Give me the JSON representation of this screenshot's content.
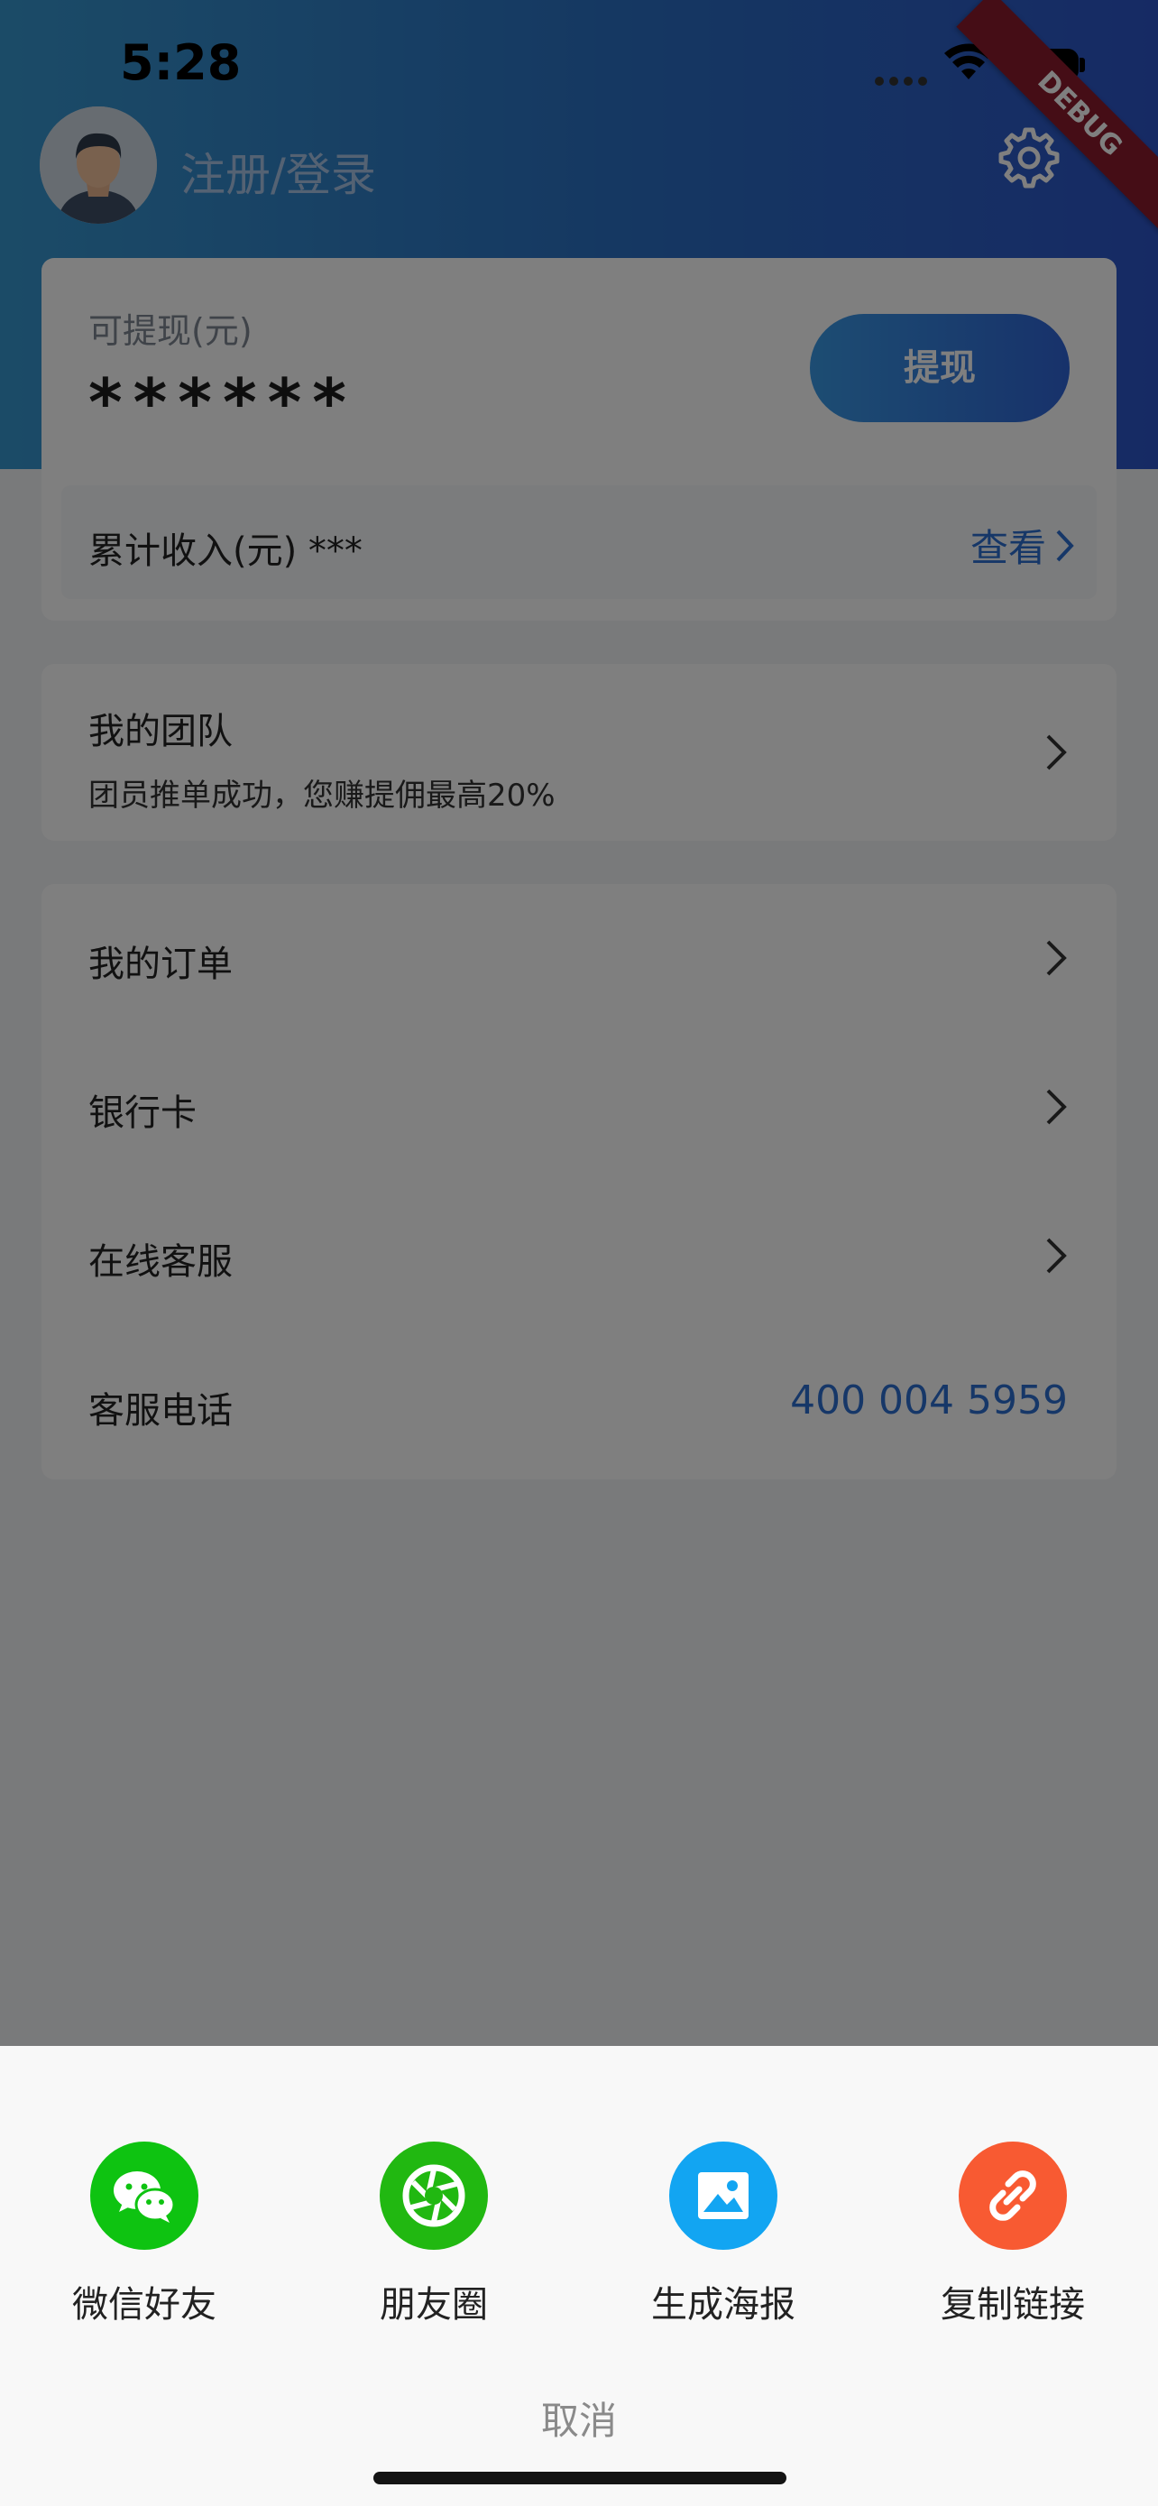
{
  "status_bar": {
    "time": "5:28",
    "debug_label": "DEBUG"
  },
  "header": {
    "login_text": "注册/登录"
  },
  "balance_card": {
    "withdrawable_label": "可提现(元)",
    "withdrawable_value": "******",
    "withdraw_button": "提现",
    "income_label": "累计收入(元) ***",
    "view_link": "查看"
  },
  "team_card": {
    "title": "我的团队",
    "subtitle": "团员推单成功，您赚提佣最高20%"
  },
  "menu": {
    "items": [
      {
        "label": "我的订单"
      },
      {
        "label": "银行卡"
      },
      {
        "label": "在线客服"
      },
      {
        "label": "客服电话",
        "value": "400 004 5959"
      }
    ]
  },
  "share_sheet": {
    "items": [
      {
        "label": "微信好友",
        "icon": "wechat-icon",
        "color": "#0ec311"
      },
      {
        "label": "朋友圈",
        "icon": "moments-icon",
        "color": "#21b811"
      },
      {
        "label": "生成海报",
        "icon": "image-icon",
        "color": "#12a5f2"
      },
      {
        "label": "复制链接",
        "icon": "link-icon",
        "color": "#f85a32"
      }
    ],
    "cancel": "取消"
  },
  "colors": {
    "accent": "#2c6fd1",
    "header_start": "#3797cf",
    "header_end": "#2d55c9"
  }
}
